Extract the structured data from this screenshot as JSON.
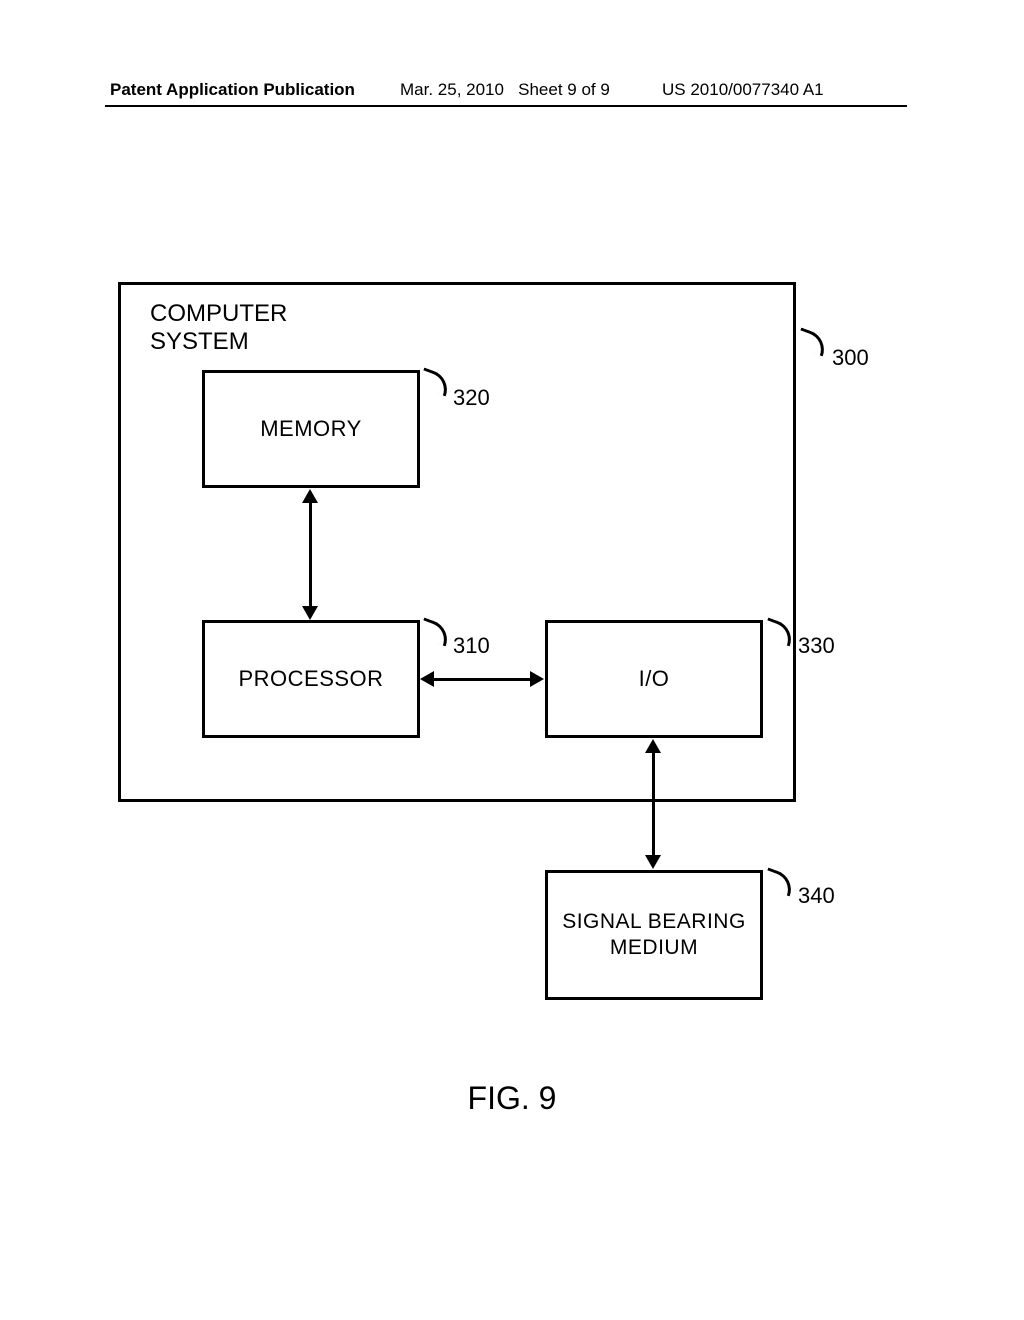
{
  "header": {
    "left": "Patent Application Publication",
    "date": "Mar. 25, 2010",
    "sheet": "Sheet 9 of 9",
    "pubno": "US 2010/0077340 A1"
  },
  "diagram": {
    "outer_title": "COMPUTER SYSTEM",
    "memory": "MEMORY",
    "processor": "PROCESSOR",
    "io": "I/O",
    "medium": "SIGNAL BEARING MEDIUM",
    "refs": {
      "outer": "300",
      "processor": "310",
      "memory": "320",
      "io": "330",
      "medium": "340"
    }
  },
  "figure_caption": "FIG. 9"
}
